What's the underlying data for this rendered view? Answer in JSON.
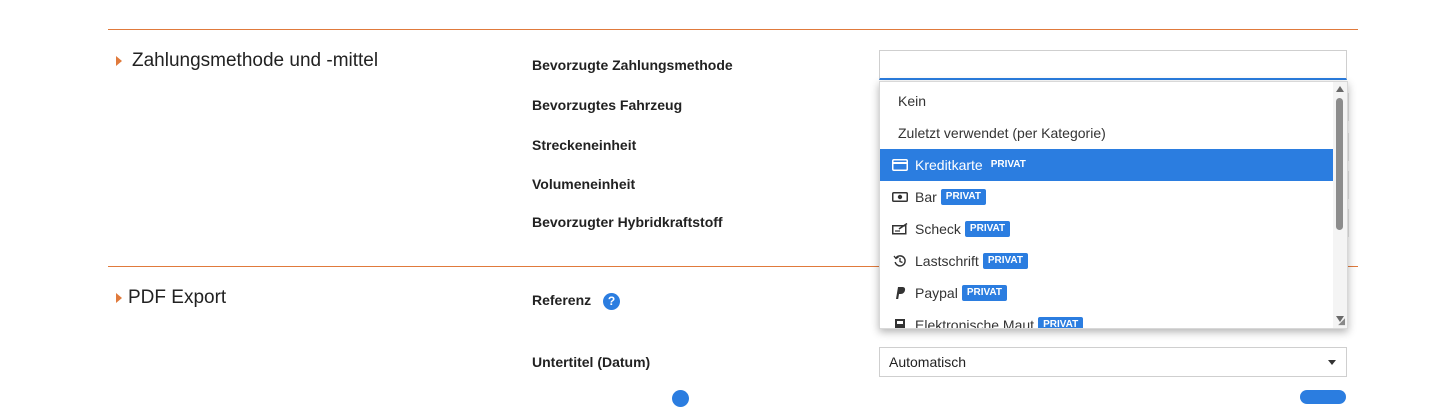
{
  "sections": {
    "payment": {
      "title": "Zahlungsmethode und -mittel"
    },
    "pdf": {
      "title": "PDF Export"
    }
  },
  "labels": {
    "preferred_payment": "Bevorzugte Zahlungsmethode",
    "preferred_vehicle": "Bevorzugtes Fahrzeug",
    "distance_unit": "Streckeneinheit",
    "volume_unit": "Volumeneinheit",
    "hybrid_fuel": "Bevorzugter Hybridkraftstoff",
    "reference": "Referenz",
    "subtitle_date": "Untertitel (Datum)"
  },
  "fields": {
    "preferred_payment_value": "",
    "subtitle_date_value": "Automatisch"
  },
  "dropdown": {
    "options": [
      {
        "label": "Kein",
        "icon": "",
        "badge": ""
      },
      {
        "label": "Zuletzt verwendet (per Kategorie)",
        "icon": "",
        "badge": ""
      },
      {
        "label": "Kreditkarte",
        "icon": "credit-card-icon",
        "badge": "PRIVAT",
        "selected": true
      },
      {
        "label": "Bar",
        "icon": "cash-icon",
        "badge": "PRIVAT"
      },
      {
        "label": "Scheck",
        "icon": "check-icon",
        "badge": "PRIVAT"
      },
      {
        "label": "Lastschrift",
        "icon": "history-icon",
        "badge": "PRIVAT"
      },
      {
        "label": "Paypal",
        "icon": "paypal-icon",
        "badge": "PRIVAT"
      },
      {
        "label": "Elektronische Maut",
        "icon": "toll-icon",
        "badge": "PRIVAT"
      }
    ]
  },
  "help_icon_char": "?",
  "colors": {
    "accent": "#2b7de0",
    "divider": "#e07a3c"
  }
}
